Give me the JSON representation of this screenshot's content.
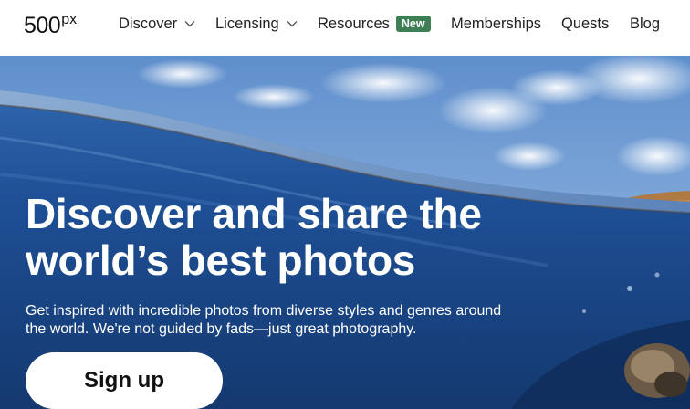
{
  "logo": {
    "main": "500",
    "sup": "px"
  },
  "nav": {
    "discover": "Discover",
    "licensing": "Licensing",
    "resources": "Resources",
    "resources_badge": "New",
    "memberships": "Memberships",
    "quests": "Quests",
    "blog": "Blog"
  },
  "hero": {
    "headline_line1": "Discover and share the",
    "headline_line2": "world’s best photos",
    "subtext_line1": "Get inspired with incredible photos from diverse styles and genres around",
    "subtext_line2": "the world. We're not guided by fads—just great photography.",
    "cta_label": "Sign up"
  },
  "colors": {
    "badge": "#3f7f56",
    "sky": "#6f9bd4",
    "water": "#1d4f95",
    "text_dark": "#222222"
  }
}
